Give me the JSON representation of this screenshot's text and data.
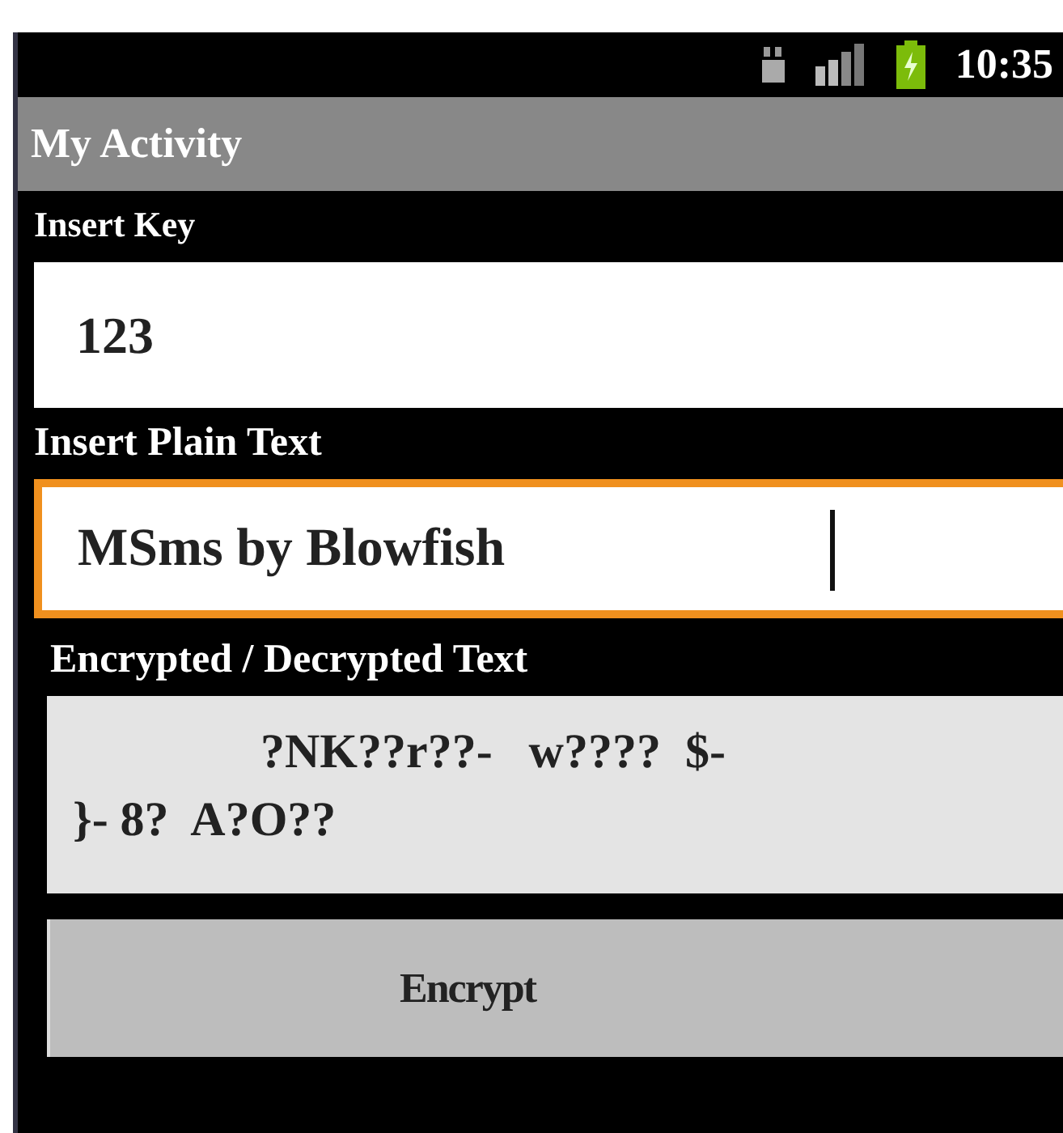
{
  "status_bar": {
    "time": "10:35"
  },
  "title_bar": {
    "title": "My Activity"
  },
  "fields": [
    {
      "label": "Insert Key",
      "value": "123",
      "focused": false
    },
    {
      "label": "Insert Plain Text",
      "value": "MSms by Blowfish",
      "focused": true
    }
  ],
  "output": {
    "label": "Encrypted / Decrypted Text",
    "lines": [
      "?NK??r??-   w????  $-",
      "}- 8?  A?O??"
    ]
  },
  "button": {
    "label": "Encrypt"
  }
}
